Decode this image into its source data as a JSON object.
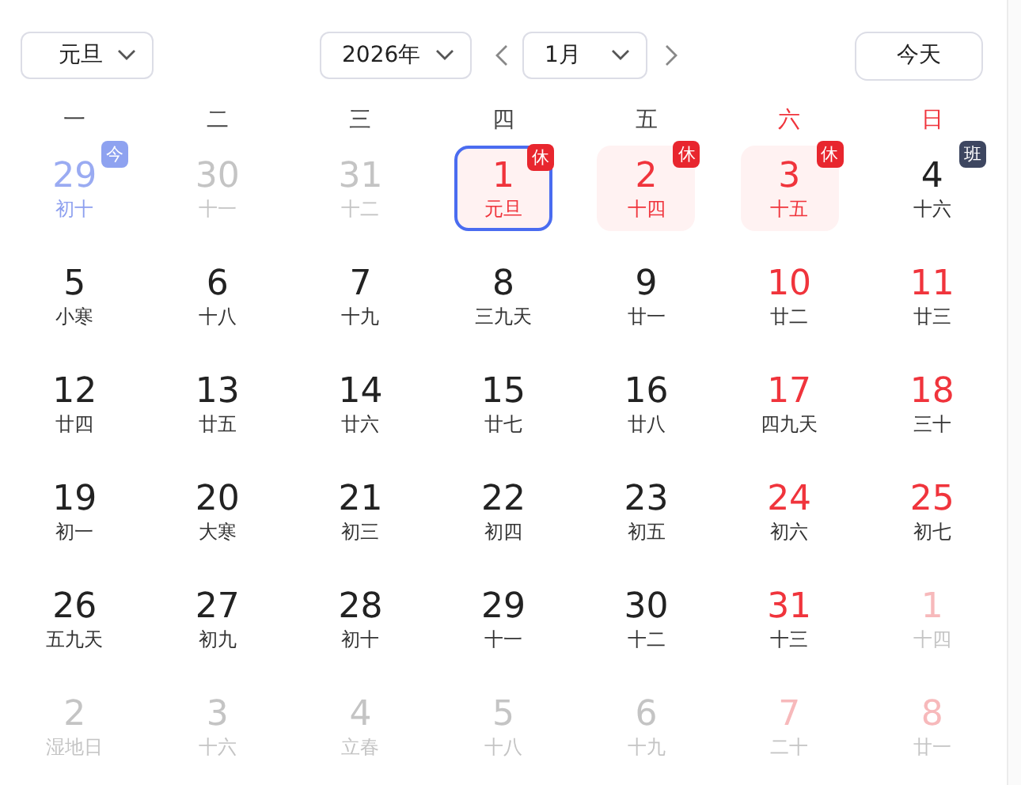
{
  "holiday_select": {
    "value": "元旦"
  },
  "year_select": {
    "value": "2026年"
  },
  "month_select": {
    "value": "1月"
  },
  "today_button": "今天",
  "weekdays": [
    {
      "label": "一",
      "weekend": false
    },
    {
      "label": "二",
      "weekend": false
    },
    {
      "label": "三",
      "weekend": false
    },
    {
      "label": "四",
      "weekend": false
    },
    {
      "label": "五",
      "weekend": false
    },
    {
      "label": "六",
      "weekend": true
    },
    {
      "label": "日",
      "weekend": true
    }
  ],
  "days": [
    {
      "day": "29",
      "lunar": "初十",
      "other_month": true,
      "red": false,
      "today": true,
      "selected": false,
      "holiday": false,
      "badge": {
        "kind": "today",
        "text": "今"
      }
    },
    {
      "day": "30",
      "lunar": "十一",
      "other_month": true,
      "red": false,
      "today": false,
      "selected": false,
      "holiday": false
    },
    {
      "day": "31",
      "lunar": "十二",
      "other_month": true,
      "red": false,
      "today": false,
      "selected": false,
      "holiday": false
    },
    {
      "day": "1",
      "lunar": "元旦",
      "other_month": false,
      "red": true,
      "today": false,
      "selected": true,
      "holiday": true,
      "badge": {
        "kind": "rest",
        "text": "休"
      }
    },
    {
      "day": "2",
      "lunar": "十四",
      "other_month": false,
      "red": true,
      "today": false,
      "selected": false,
      "holiday": true,
      "badge": {
        "kind": "rest",
        "text": "休"
      }
    },
    {
      "day": "3",
      "lunar": "十五",
      "other_month": false,
      "red": true,
      "today": false,
      "selected": false,
      "holiday": true,
      "badge": {
        "kind": "rest",
        "text": "休"
      }
    },
    {
      "day": "4",
      "lunar": "十六",
      "other_month": false,
      "red": false,
      "today": false,
      "selected": false,
      "holiday": false,
      "badge": {
        "kind": "work",
        "text": "班"
      }
    },
    {
      "day": "5",
      "lunar": "小寒",
      "other_month": false,
      "red": false,
      "today": false,
      "selected": false,
      "holiday": false
    },
    {
      "day": "6",
      "lunar": "十八",
      "other_month": false,
      "red": false,
      "today": false,
      "selected": false,
      "holiday": false
    },
    {
      "day": "7",
      "lunar": "十九",
      "other_month": false,
      "red": false,
      "today": false,
      "selected": false,
      "holiday": false
    },
    {
      "day": "8",
      "lunar": "三九天",
      "other_month": false,
      "red": false,
      "today": false,
      "selected": false,
      "holiday": false
    },
    {
      "day": "9",
      "lunar": "廿一",
      "other_month": false,
      "red": false,
      "today": false,
      "selected": false,
      "holiday": false
    },
    {
      "day": "10",
      "lunar": "廿二",
      "other_month": false,
      "red": true,
      "today": false,
      "selected": false,
      "holiday": false
    },
    {
      "day": "11",
      "lunar": "廿三",
      "other_month": false,
      "red": true,
      "today": false,
      "selected": false,
      "holiday": false
    },
    {
      "day": "12",
      "lunar": "廿四",
      "other_month": false,
      "red": false,
      "today": false,
      "selected": false,
      "holiday": false
    },
    {
      "day": "13",
      "lunar": "廿五",
      "other_month": false,
      "red": false,
      "today": false,
      "selected": false,
      "holiday": false
    },
    {
      "day": "14",
      "lunar": "廿六",
      "other_month": false,
      "red": false,
      "today": false,
      "selected": false,
      "holiday": false
    },
    {
      "day": "15",
      "lunar": "廿七",
      "other_month": false,
      "red": false,
      "today": false,
      "selected": false,
      "holiday": false
    },
    {
      "day": "16",
      "lunar": "廿八",
      "other_month": false,
      "red": false,
      "today": false,
      "selected": false,
      "holiday": false
    },
    {
      "day": "17",
      "lunar": "四九天",
      "other_month": false,
      "red": true,
      "today": false,
      "selected": false,
      "holiday": false
    },
    {
      "day": "18",
      "lunar": "三十",
      "other_month": false,
      "red": true,
      "today": false,
      "selected": false,
      "holiday": false
    },
    {
      "day": "19",
      "lunar": "初一",
      "other_month": false,
      "red": false,
      "today": false,
      "selected": false,
      "holiday": false
    },
    {
      "day": "20",
      "lunar": "大寒",
      "other_month": false,
      "red": false,
      "today": false,
      "selected": false,
      "holiday": false
    },
    {
      "day": "21",
      "lunar": "初三",
      "other_month": false,
      "red": false,
      "today": false,
      "selected": false,
      "holiday": false
    },
    {
      "day": "22",
      "lunar": "初四",
      "other_month": false,
      "red": false,
      "today": false,
      "selected": false,
      "holiday": false
    },
    {
      "day": "23",
      "lunar": "初五",
      "other_month": false,
      "red": false,
      "today": false,
      "selected": false,
      "holiday": false
    },
    {
      "day": "24",
      "lunar": "初六",
      "other_month": false,
      "red": true,
      "today": false,
      "selected": false,
      "holiday": false
    },
    {
      "day": "25",
      "lunar": "初七",
      "other_month": false,
      "red": true,
      "today": false,
      "selected": false,
      "holiday": false
    },
    {
      "day": "26",
      "lunar": "五九天",
      "other_month": false,
      "red": false,
      "today": false,
      "selected": false,
      "holiday": false
    },
    {
      "day": "27",
      "lunar": "初九",
      "other_month": false,
      "red": false,
      "today": false,
      "selected": false,
      "holiday": false
    },
    {
      "day": "28",
      "lunar": "初十",
      "other_month": false,
      "red": false,
      "today": false,
      "selected": false,
      "holiday": false
    },
    {
      "day": "29",
      "lunar": "十一",
      "other_month": false,
      "red": false,
      "today": false,
      "selected": false,
      "holiday": false
    },
    {
      "day": "30",
      "lunar": "十二",
      "other_month": false,
      "red": false,
      "today": false,
      "selected": false,
      "holiday": false
    },
    {
      "day": "31",
      "lunar": "十三",
      "other_month": false,
      "red": true,
      "today": false,
      "selected": false,
      "holiday": false
    },
    {
      "day": "1",
      "lunar": "十四",
      "other_month": true,
      "red": true,
      "today": false,
      "selected": false,
      "holiday": false
    },
    {
      "day": "2",
      "lunar": "湿地日",
      "other_month": true,
      "red": false,
      "today": false,
      "selected": false,
      "holiday": false
    },
    {
      "day": "3",
      "lunar": "十六",
      "other_month": true,
      "red": false,
      "today": false,
      "selected": false,
      "holiday": false
    },
    {
      "day": "4",
      "lunar": "立春",
      "other_month": true,
      "red": false,
      "today": false,
      "selected": false,
      "holiday": false
    },
    {
      "day": "5",
      "lunar": "十八",
      "other_month": true,
      "red": false,
      "today": false,
      "selected": false,
      "holiday": false
    },
    {
      "day": "6",
      "lunar": "十九",
      "other_month": true,
      "red": false,
      "today": false,
      "selected": false,
      "holiday": false
    },
    {
      "day": "7",
      "lunar": "二十",
      "other_month": true,
      "red": true,
      "today": false,
      "selected": false,
      "holiday": false
    },
    {
      "day": "8",
      "lunar": "廿一",
      "other_month": true,
      "red": true,
      "today": false,
      "selected": false,
      "holiday": false
    }
  ]
}
